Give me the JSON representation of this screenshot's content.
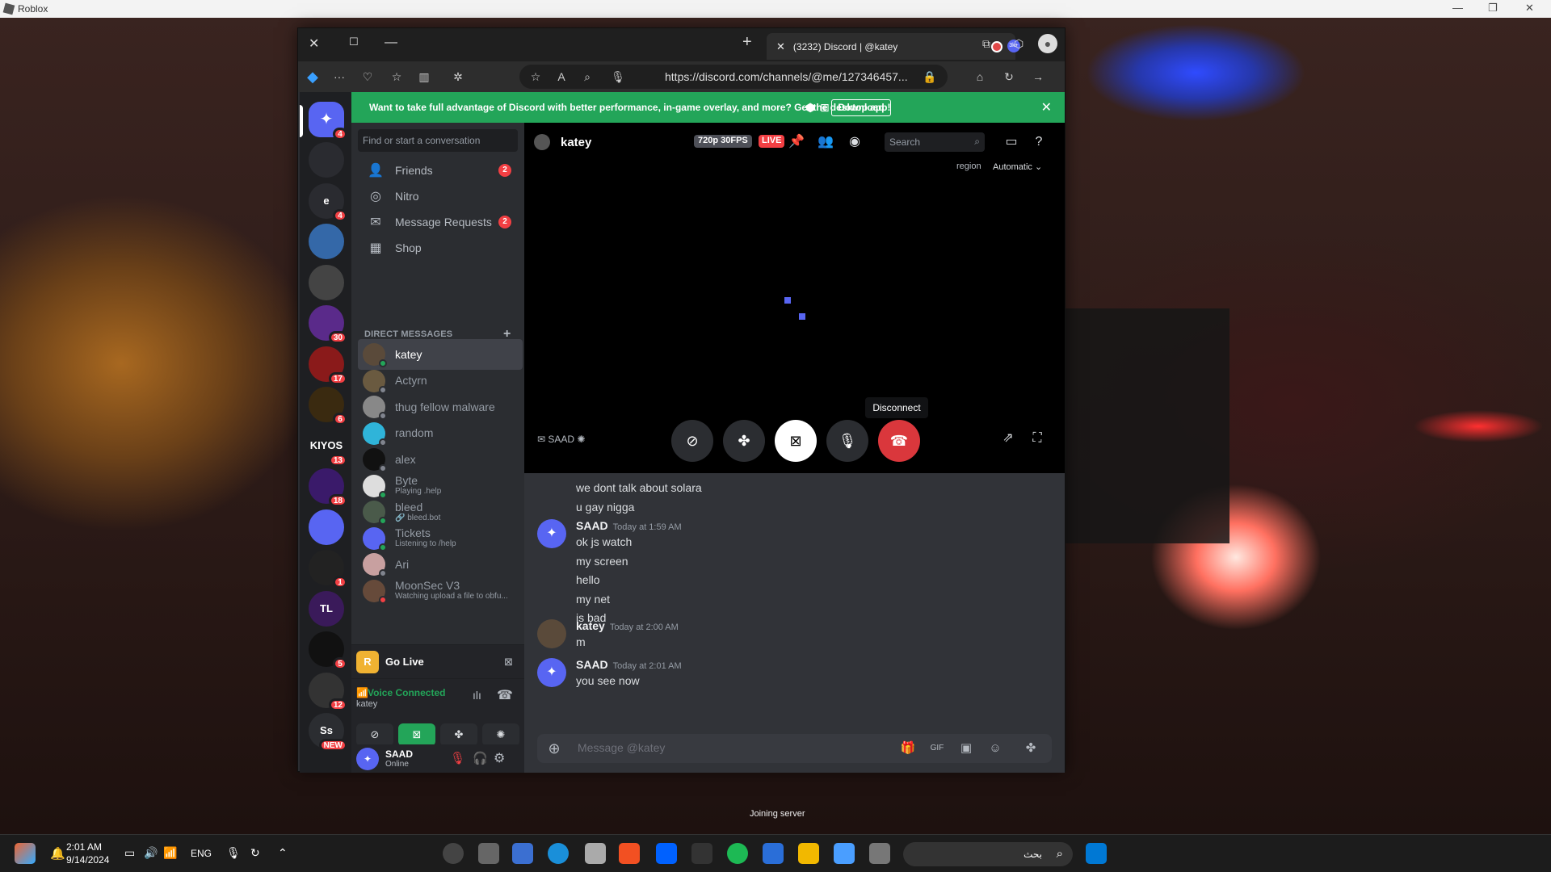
{
  "window": {
    "title": "Roblox"
  },
  "browser": {
    "tab_title": "(3232) Discord | @katey",
    "tab_badge": "3k+",
    "url": "https://discord.com/channels/@me/127346457...",
    "url_host": "discord.com"
  },
  "banner": {
    "text": "Want to take full advantage of Discord with better performance, in-game overlay, and more? Get the desktop app!",
    "download_label": "Download"
  },
  "server_rail": {
    "home_badge": "4",
    "items": [
      {
        "label": "",
        "badge": ""
      },
      {
        "label": "e",
        "badge": "4"
      },
      {
        "label": "",
        "badge": ""
      },
      {
        "label": "",
        "badge": ""
      },
      {
        "label": "",
        "badge": "30"
      },
      {
        "label": "",
        "badge": "17"
      },
      {
        "label": "",
        "badge": "6"
      },
      {
        "label": "KIYOS",
        "badge": "13"
      },
      {
        "label": "",
        "badge": "18"
      },
      {
        "label": "",
        "badge": ""
      },
      {
        "label": "",
        "badge": "1"
      },
      {
        "label": "TL",
        "badge": ""
      },
      {
        "label": "",
        "badge": "5"
      },
      {
        "label": "",
        "badge": "12"
      },
      {
        "label": "Ss",
        "badge": "NEW"
      }
    ]
  },
  "dm_sidebar": {
    "search_placeholder": "Find or start a conversation",
    "nav": [
      {
        "label": "Friends",
        "badge": "2"
      },
      {
        "label": "Nitro",
        "badge": ""
      },
      {
        "label": "Message Requests",
        "badge": "2"
      },
      {
        "label": "Shop",
        "badge": ""
      }
    ],
    "dm_header": "DIRECT MESSAGES",
    "dms": [
      {
        "name": "katey",
        "sub": "",
        "status": "online"
      },
      {
        "name": "Actyrn",
        "sub": "",
        "status": "offline"
      },
      {
        "name": "thug fellow malware",
        "sub": "",
        "status": "offline"
      },
      {
        "name": "random",
        "sub": "",
        "status": "offline"
      },
      {
        "name": "alex",
        "sub": "",
        "status": "offline"
      },
      {
        "name": "Byte",
        "sub": "Playing .help",
        "status": "online"
      },
      {
        "name": "bleed",
        "sub": "🔗 bleed.bot",
        "status": "online"
      },
      {
        "name": "Tickets",
        "sub": "Listening to /help",
        "status": "online"
      },
      {
        "name": "Ari",
        "sub": "",
        "status": "offline"
      },
      {
        "name": "MoonSec V3",
        "sub": "Watching upload a file to obfu...",
        "status": "dnd"
      }
    ],
    "go_live": "Go Live",
    "voice": {
      "status": "Voice Connected",
      "channel": "katey"
    },
    "user": {
      "name": "SAAD",
      "status": "Online"
    }
  },
  "call": {
    "channel_name": "katey",
    "quality": "720p 30FPS",
    "live": "LIVE",
    "search_placeholder": "Search",
    "region_label": "region",
    "region_value": "Automatic",
    "participant_label": "SAAD",
    "tooltip": "Disconnect"
  },
  "messages": [
    {
      "author": "",
      "time": "",
      "lines": [
        "we dont talk about solara",
        "u gay nigga"
      ]
    },
    {
      "author": "SAAD",
      "time": "Today at 1:59 AM",
      "lines": [
        "ok js watch",
        "my screen",
        "hello",
        "my net",
        "is bad"
      ]
    },
    {
      "author": "katey",
      "time": "Today at 2:00 AM",
      "lines": [
        "m"
      ]
    },
    {
      "author": "SAAD",
      "time": "Today at 2:01 AM",
      "lines": [
        "you see now"
      ]
    }
  ],
  "composer": {
    "placeholder": "Message @katey"
  },
  "overlay": {
    "joining": "Joining server"
  },
  "taskbar": {
    "time": "2:01 AM",
    "date": "9/14/2024",
    "language": "ENG",
    "search_placeholder": "بحث"
  },
  "colors": {
    "discord_blurple": "#5865f2",
    "green": "#23a559",
    "red": "#f23f43"
  }
}
